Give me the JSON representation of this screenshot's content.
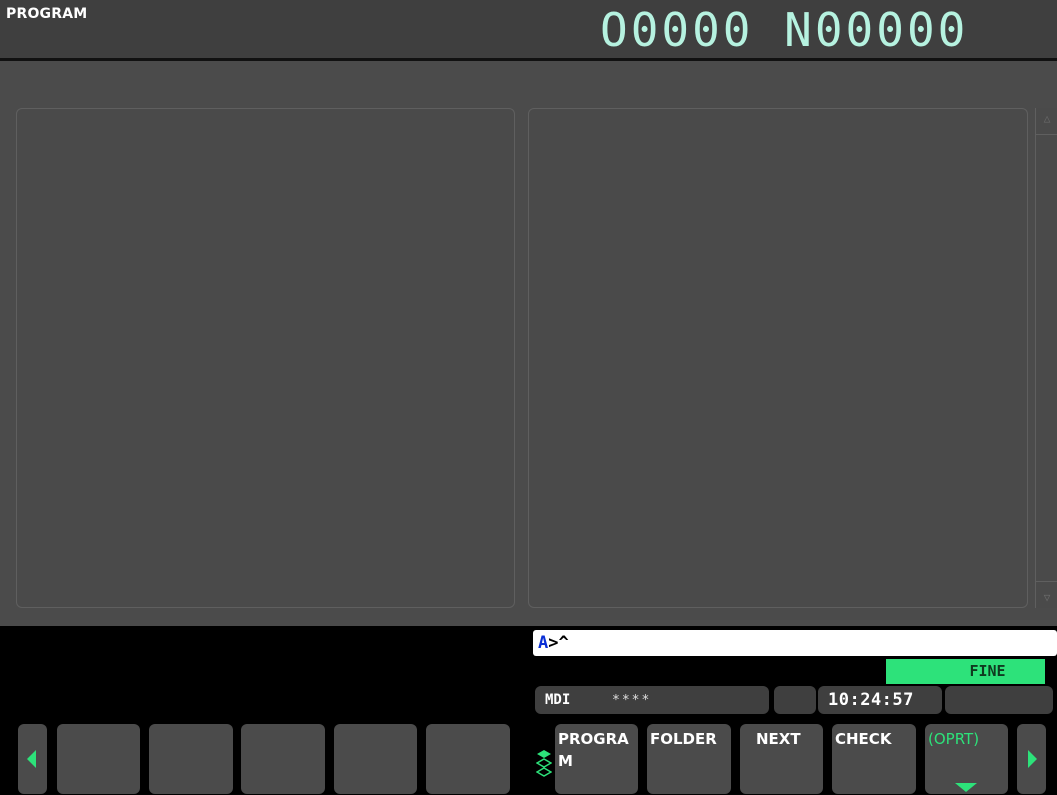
{
  "header": {
    "screen_title": "PROGRAM",
    "program_number": "O0000 N00000"
  },
  "input": {
    "prompt_prefix": "A",
    "prompt_rest": ">^"
  },
  "status": {
    "fine_label": "FINE",
    "mode": "MDI",
    "stars": "****",
    "clock": "10:24:57"
  },
  "softkeys": {
    "program_line1": "PROGRA",
    "program_line2": "M",
    "folder": "FOLDER",
    "next": "NEXT",
    "check": "CHECK",
    "oprt": "(OPRT)"
  },
  "icons": {
    "left": "arrow-left-icon",
    "right": "arrow-right-icon",
    "layers": "layers-icon",
    "scroll_up": "triangle-up-icon",
    "scroll_down": "triangle-down-icon"
  },
  "colors": {
    "accent_green": "#2de27a",
    "program_number": "#b6f2e0",
    "prompt_blue": "#0a2fd6"
  }
}
